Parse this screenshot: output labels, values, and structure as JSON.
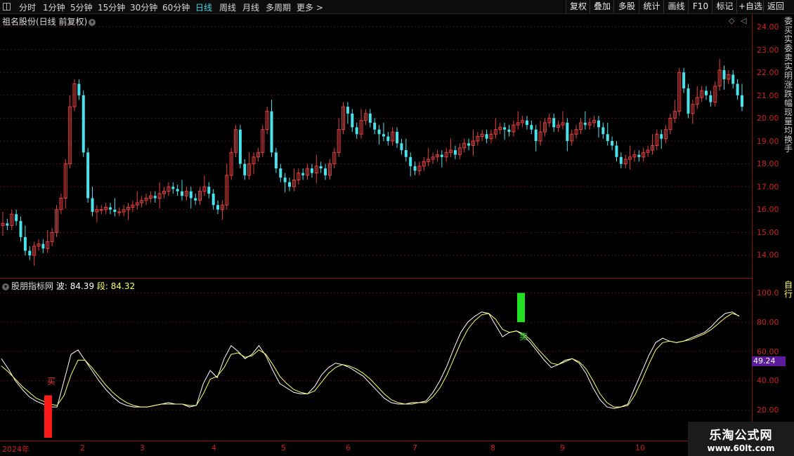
{
  "toolbar": {
    "periods": [
      "分时",
      "1分钟",
      "5分钟",
      "15分钟",
      "30分钟",
      "60分钟",
      "日线",
      "周线",
      "月线",
      "多周期",
      "更多 >"
    ],
    "active_period": "日线",
    "right_buttons": [
      "复权",
      "叠加",
      "多股",
      "统计",
      "画线",
      "F10",
      "标记",
      "+自选",
      "返回"
    ]
  },
  "main_chart": {
    "title": "祖名股份(日线 前复权)",
    "price_labels": [
      "24.00",
      "23.00",
      "22.00",
      "21.00",
      "20.00",
      "19.00",
      "18.00",
      "17.00",
      "16.00",
      "15.00",
      "14.00"
    ],
    "up_color": "#e84040",
    "down_color": "#49e3ee"
  },
  "indicator": {
    "name": "股朋指标网",
    "wave_label": "波:",
    "wave_value": "84.39",
    "seg_label": "段:",
    "seg_value": "84.32",
    "axis_labels": [
      "100.0",
      "80.00",
      "60.00",
      "40.00",
      "20.00"
    ],
    "current_tag": "49.24",
    "buy_label": "买",
    "sell_label": "卖",
    "wave_color": "#ffffff",
    "seg_color": "#ffff66"
  },
  "date_axis": [
    "2024年",
    "2",
    "3",
    "4",
    "5",
    "6",
    "7",
    "8",
    "9",
    "10"
  ],
  "right_panel_text": {
    "top": "委买实委卖实明涨跌幅现量均换手",
    "bottom": "自行"
  },
  "watermark": {
    "line1": "乐淘公式网",
    "line2": "www.60lt.com"
  },
  "chart_data": [
    {
      "type": "candlestick",
      "title": "祖名股份(日线 前复权)",
      "ylim": [
        13.5,
        24.4
      ],
      "x_labels": [
        "2024年",
        "2",
        "3",
        "4",
        "5",
        "6",
        "7",
        "8",
        "9",
        "10"
      ],
      "series": [
        {
          "name": "close",
          "values": [
            15.4,
            15.3,
            15.8,
            15.5,
            14.8,
            14.2,
            14.0,
            14.4,
            14.5,
            14.3,
            14.6,
            15.0,
            16.0,
            16.5,
            18.0,
            20.5,
            21.5,
            21.0,
            18.5,
            16.5,
            15.9,
            16.0,
            16.0,
            16.1,
            16.0,
            15.9,
            15.9,
            16.0,
            16.1,
            16.2,
            16.3,
            16.4,
            16.5,
            16.6,
            16.5,
            16.7,
            16.8,
            17.0,
            16.9,
            16.8,
            16.6,
            16.8,
            16.5,
            16.4,
            16.8,
            17.0,
            16.7,
            16.2,
            16.0,
            16.2,
            17.5,
            18.5,
            19.5,
            18.0,
            17.5,
            18.0,
            18.3,
            18.5,
            19.5,
            20.3,
            18.5,
            17.8,
            17.4,
            17.2,
            17.0,
            17.3,
            17.6,
            17.5,
            17.8,
            17.6,
            17.9,
            17.8,
            17.5,
            18.0,
            18.5,
            19.5,
            20.5,
            20.2,
            19.6,
            19.3,
            19.9,
            20.2,
            19.8,
            19.5,
            19.3,
            19.2,
            19.0,
            19.4,
            18.9,
            18.6,
            18.3,
            17.9,
            17.7,
            17.9,
            18.1,
            18.2,
            18.3,
            18.4,
            18.3,
            18.5,
            18.6,
            18.4,
            18.7,
            18.9,
            18.8,
            19.0,
            19.2,
            19.3,
            19.1,
            19.3,
            19.5,
            19.6,
            19.5,
            19.4,
            19.7,
            19.8,
            19.9,
            19.7,
            19.5,
            19.0,
            19.4,
            19.8,
            20.0,
            19.6,
            19.7,
            19.8,
            19.0,
            19.3,
            19.5,
            19.8,
            19.7,
            19.8,
            19.9,
            19.6,
            19.3,
            19.0,
            18.8,
            18.3,
            18.0,
            18.2,
            18.3,
            18.4,
            18.3,
            18.5,
            18.6,
            18.8,
            19.3,
            19.1,
            19.5,
            20.0,
            20.3,
            22.0,
            21.3,
            20.2,
            20.6,
            20.9,
            21.2,
            21.0,
            20.7,
            21.4,
            22.1,
            21.7,
            21.9,
            21.5,
            21.0,
            20.5
          ]
        }
      ]
    },
    {
      "type": "line",
      "title": "股朋指标网",
      "ylim": [
        0,
        105
      ],
      "series": [
        {
          "name": "波",
          "values": [
            55,
            48,
            40,
            34,
            29,
            26,
            24,
            22,
            22,
            40,
            58,
            61,
            54,
            47,
            40,
            34,
            29,
            25,
            23,
            22,
            22,
            22,
            23,
            24,
            25,
            24,
            24,
            22,
            23,
            38,
            47,
            42,
            55,
            64,
            60,
            55,
            58,
            64,
            57,
            47,
            38,
            35,
            32,
            31,
            31,
            36,
            44,
            49,
            52,
            51,
            49,
            46,
            43,
            38,
            33,
            28,
            25,
            24,
            24,
            25,
            25,
            26,
            32,
            40,
            50,
            62,
            73,
            80,
            84,
            87,
            86,
            78,
            70,
            73,
            74,
            71,
            66,
            60,
            54,
            49,
            51,
            54,
            55,
            52,
            45,
            35,
            27,
            22,
            21,
            22,
            24,
            35,
            46,
            57,
            66,
            69,
            67,
            66,
            67,
            69,
            71,
            73,
            77,
            82,
            86,
            87,
            84
          ]
        },
        {
          "name": "段",
          "values": [
            50,
            46,
            41,
            36,
            32,
            28,
            26,
            24,
            23,
            30,
            44,
            54,
            54,
            49,
            43,
            37,
            32,
            28,
            25,
            23,
            22,
            22,
            23,
            24,
            24,
            24,
            24,
            23,
            23,
            31,
            41,
            43,
            49,
            58,
            59,
            56,
            57,
            61,
            58,
            51,
            43,
            38,
            34,
            32,
            31,
            33,
            39,
            45,
            49,
            51,
            50,
            48,
            45,
            41,
            36,
            31,
            27,
            25,
            24,
            24,
            25,
            25,
            29,
            35,
            44,
            55,
            66,
            75,
            81,
            85,
            86,
            82,
            75,
            73,
            74,
            72,
            68,
            62,
            57,
            52,
            51,
            53,
            55,
            53,
            48,
            40,
            31,
            25,
            22,
            22,
            23,
            30,
            40,
            51,
            61,
            66,
            67,
            66,
            67,
            68,
            70,
            72,
            75,
            79,
            83,
            86,
            84.3
          ]
        }
      ],
      "signals": [
        {
          "label": "买",
          "value": 30
        },
        {
          "label": "卖",
          "value": 100
        }
      ]
    }
  ]
}
